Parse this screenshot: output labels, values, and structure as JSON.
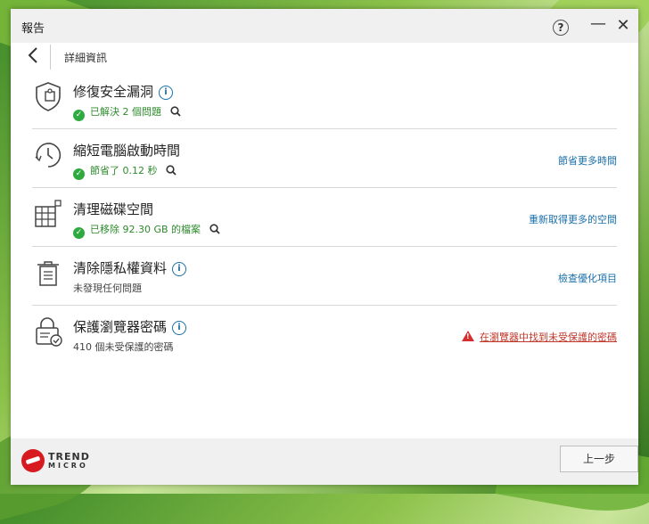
{
  "window": {
    "title": "報告"
  },
  "titlebar": {
    "help_icon": "help-icon",
    "minimize_icon": "minimize-icon",
    "close_icon": "close-icon"
  },
  "nav": {
    "back_icon": "back-arrow-icon",
    "breadcrumb": "詳細資訊"
  },
  "items": [
    {
      "icon": "shield-puzzle-icon",
      "title": "修復安全漏洞",
      "has_info": true,
      "status": "已解決 2 個問題",
      "status_type": "ok",
      "has_search": true,
      "action": ""
    },
    {
      "icon": "clock-speed-icon",
      "title": "縮短電腦啟動時間",
      "has_info": false,
      "status": "節省了 0.12 秒",
      "status_type": "ok",
      "has_search": true,
      "action": "節省更多時間"
    },
    {
      "icon": "disk-grid-icon",
      "title": "清理磁碟空間",
      "has_info": false,
      "status": "已移除 92.30 GB 的檔案",
      "status_type": "ok",
      "has_search": true,
      "action": "重新取得更多的空間"
    },
    {
      "icon": "trash-bin-icon",
      "title": "清除隱私權資料",
      "has_info": true,
      "status": "未發現任何問題",
      "status_type": "neutral",
      "has_search": false,
      "action": "檢查優化項目"
    },
    {
      "icon": "password-lock-icon",
      "title": "保護瀏覽器密碼",
      "has_info": true,
      "status": "410 個未受保護的密碼",
      "status_type": "neutral",
      "has_search": false,
      "action": "在瀏覽器中找到未受保護的密碼",
      "action_type": "warning"
    }
  ],
  "footer": {
    "logo_line1": "TREND",
    "logo_line2": "MICRO",
    "back_button": "上一步"
  },
  "colors": {
    "accent": "#1a6fa8",
    "ok": "#2e8b2e",
    "warning": "#c0392b",
    "brand": "#d71920"
  }
}
